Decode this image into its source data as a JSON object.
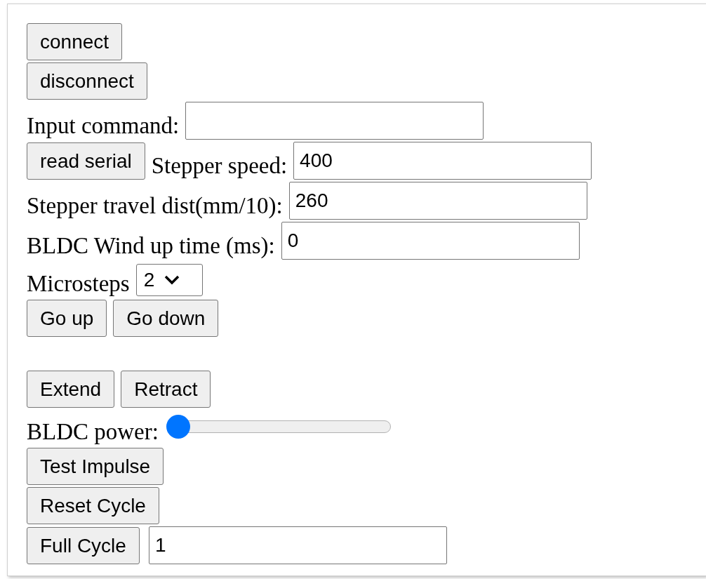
{
  "sections": [
    {
      "rows": [
        [
          {
            "kind": "button",
            "label": "connect"
          }
        ],
        [
          {
            "kind": "button",
            "label": "disconnect"
          }
        ],
        [
          {
            "kind": "label",
            "text": "Input command:"
          },
          {
            "kind": "input"
          }
        ],
        [
          {
            "kind": "button",
            "label": "read serial"
          },
          {
            "kind": "label",
            "text": "Stepper speed:"
          },
          {
            "kind": "input",
            "value": "400"
          }
        ],
        [
          {
            "kind": "label",
            "text": "Stepper travel dist(mm/10):"
          },
          {
            "kind": "input",
            "value": "260"
          }
        ],
        [
          {
            "kind": "label",
            "text": "BLDC Wind up time (ms):"
          },
          {
            "kind": "input",
            "value": "0"
          }
        ],
        [
          {
            "kind": "label",
            "text": "Microsteps"
          },
          {
            "kind": "select",
            "value": "2"
          }
        ],
        [
          {
            "kind": "button",
            "label": "Go up"
          },
          {
            "kind": "button",
            "label": "Go down"
          }
        ]
      ]
    },
    {
      "rows": [
        [
          {
            "kind": "button",
            "label": "Extend"
          },
          {
            "kind": "button",
            "label": "Retract"
          }
        ],
        [
          {
            "kind": "label",
            "text": "BLDC power:"
          },
          {
            "kind": "slider",
            "level": 0
          }
        ],
        [
          {
            "kind": "button",
            "label": "Test Impulse"
          }
        ],
        [
          {
            "kind": "button",
            "label": "Reset Cycle"
          }
        ],
        [
          {
            "kind": "button",
            "label": "Full Cycle"
          },
          {
            "kind": "input",
            "value": "1"
          }
        ]
      ]
    }
  ]
}
